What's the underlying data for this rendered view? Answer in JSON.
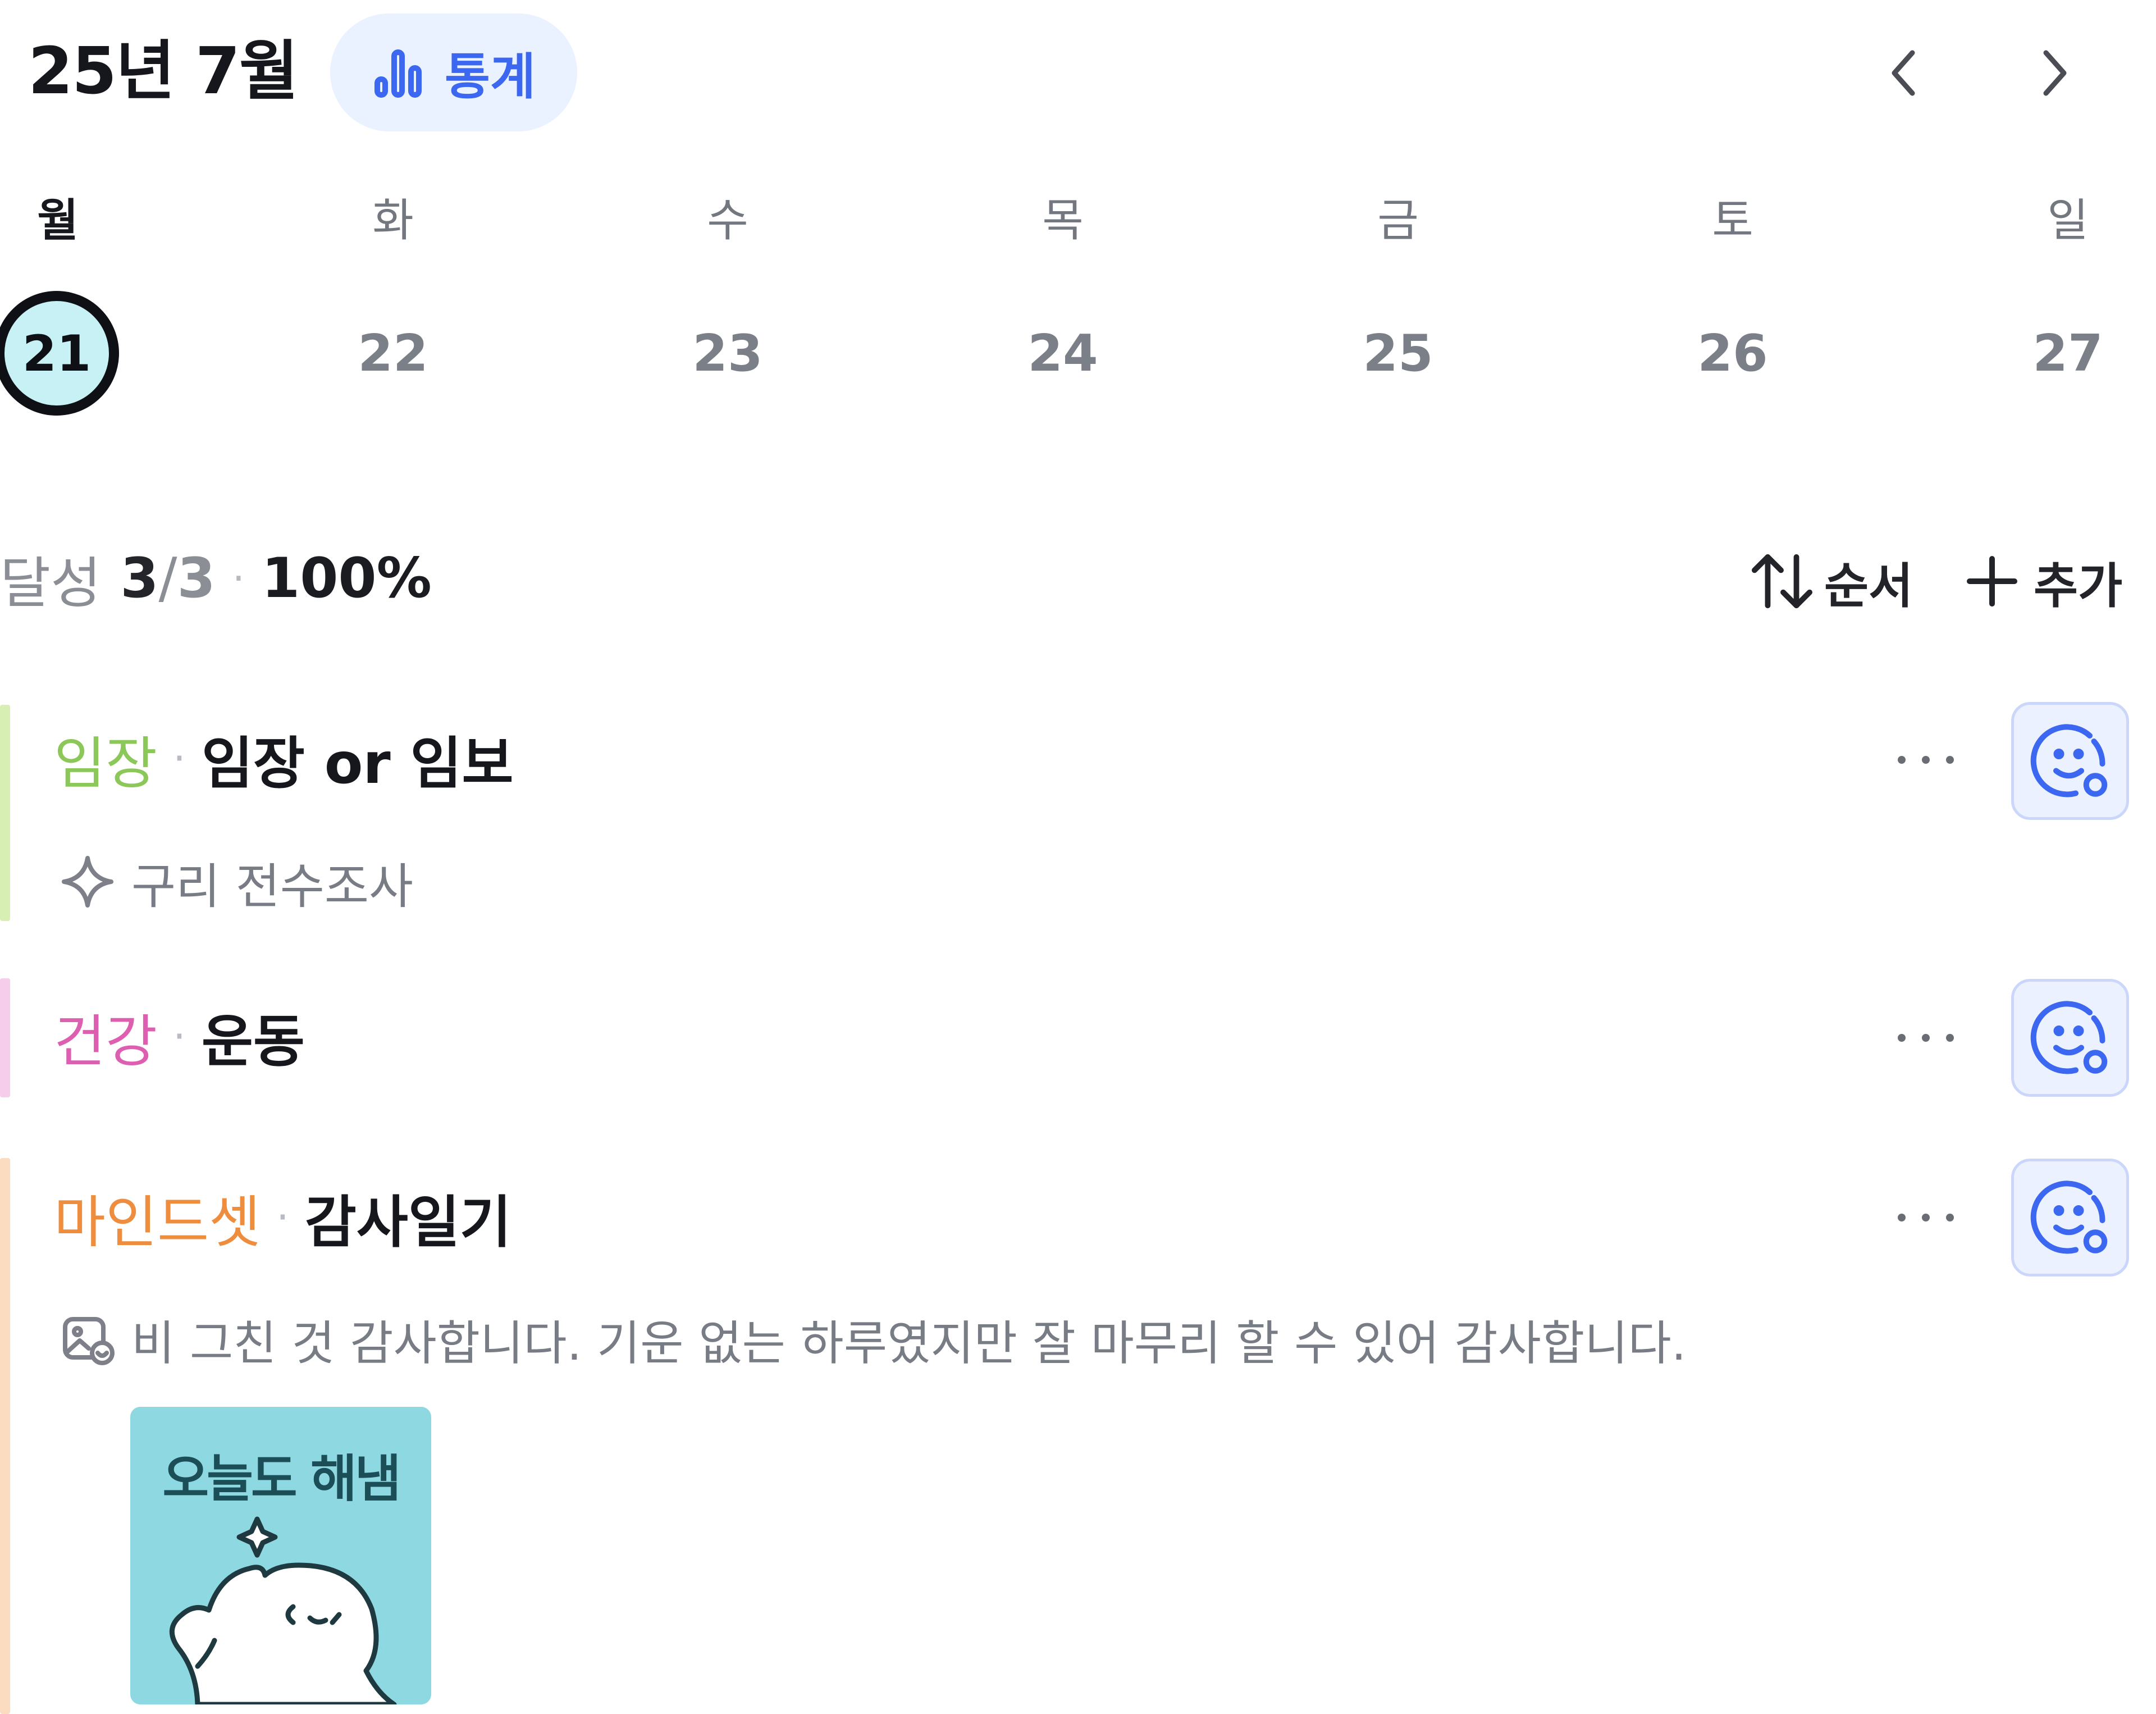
{
  "header": {
    "month_title": "25년 7월",
    "stats_label": "통계",
    "stats_icon": "bar-chart-icon",
    "prev_icon": "chevron-left-icon",
    "next_icon": "chevron-right-icon",
    "accent_color": "#3c67f0"
  },
  "week": {
    "days": [
      {
        "weekday": "월",
        "date": "21",
        "selected": true
      },
      {
        "weekday": "화",
        "date": "22",
        "selected": false
      },
      {
        "weekday": "수",
        "date": "23",
        "selected": false
      },
      {
        "weekday": "목",
        "date": "24",
        "selected": false
      },
      {
        "weekday": "금",
        "date": "25",
        "selected": false
      },
      {
        "weekday": "토",
        "date": "26",
        "selected": false
      },
      {
        "weekday": "일",
        "date": "27",
        "selected": false
      }
    ]
  },
  "summary": {
    "label": "달성",
    "done": "3",
    "slash": "/",
    "total": "3",
    "separator": "·",
    "percent": "100%"
  },
  "toolbar": {
    "sort_label": "순서",
    "add_label": "추가"
  },
  "goals": [
    {
      "category": "임장",
      "category_color": "#8cc75a",
      "bar_color": "#d8efb4",
      "separator": "·",
      "name": "임장 or 임보",
      "sub_icon": "sparkle-icon",
      "sub_text": "구리 전수조사"
    },
    {
      "category": "건강",
      "category_color": "#dc5fb0",
      "bar_color": "#f6cdea",
      "separator": "·",
      "name": "운동"
    },
    {
      "category": "마인드셋",
      "category_color": "#ee8d3d",
      "bar_color": "#fcdcc0",
      "separator": "·",
      "name": "감사일기",
      "sub_icon": "image-note-icon",
      "sub_text": "비 그친 것 감사합니다. 기운 없는 하루였지만 잘 마무리 할 수 있어 감사합니다.",
      "sticker_text": "오늘도 해냄"
    }
  ]
}
